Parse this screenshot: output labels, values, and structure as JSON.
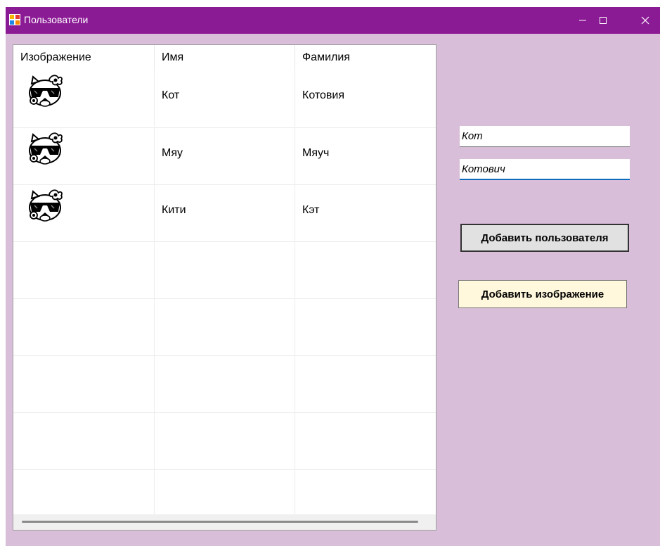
{
  "window": {
    "title": "Пользователи",
    "title_bar_color": "#8b1a95",
    "background_color": "#d8bed8",
    "controls": {
      "minimize": "minimize-icon",
      "maximize": "maximize-icon",
      "close": "close-icon"
    }
  },
  "grid": {
    "columns": [
      "Изображение",
      "Имя",
      "Фамилия"
    ],
    "rows": [
      {
        "image": "cat-sunglasses-icon",
        "first_name": "Кот",
        "last_name": "Котовия"
      },
      {
        "image": "cat-sunglasses-icon",
        "first_name": "Мяу",
        "last_name": "Мяуч"
      },
      {
        "image": "cat-sunglasses-icon",
        "first_name": "Кити",
        "last_name": "Кэт"
      }
    ],
    "empty_rows": 5
  },
  "form": {
    "first_name_value": "Кот",
    "last_name_value": "Котович",
    "add_user_label": "Добавить пользователя",
    "add_image_label": "Добавить изображение",
    "add_image_button_color": "#fff8dc",
    "focus_color": "#0f6cbd"
  }
}
